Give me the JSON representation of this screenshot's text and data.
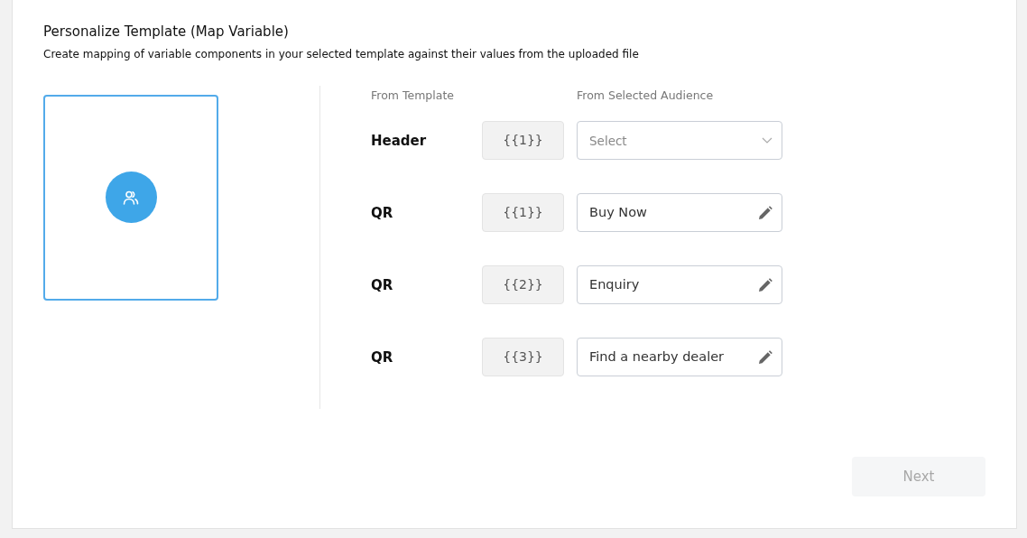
{
  "title": "Personalize Template (Map Variable)",
  "subtitle": "Create mapping of variable components in your selected template against their values from the uploaded file",
  "columns": [
    "From Template",
    "From Selected Audience"
  ],
  "rows": [
    {
      "label": "Header",
      "variable": "{{1}}",
      "kind": "select",
      "placeholder": "Select"
    },
    {
      "label": "QR",
      "variable": "{{1}}",
      "kind": "text",
      "value": "Buy Now"
    },
    {
      "label": "QR",
      "variable": "{{2}}",
      "kind": "text",
      "value": "Enquiry"
    },
    {
      "label": "QR",
      "variable": "{{3}}",
      "kind": "text",
      "value": "Find a nearby dealer"
    }
  ],
  "next_button": {
    "label": "Next",
    "disabled": true
  }
}
